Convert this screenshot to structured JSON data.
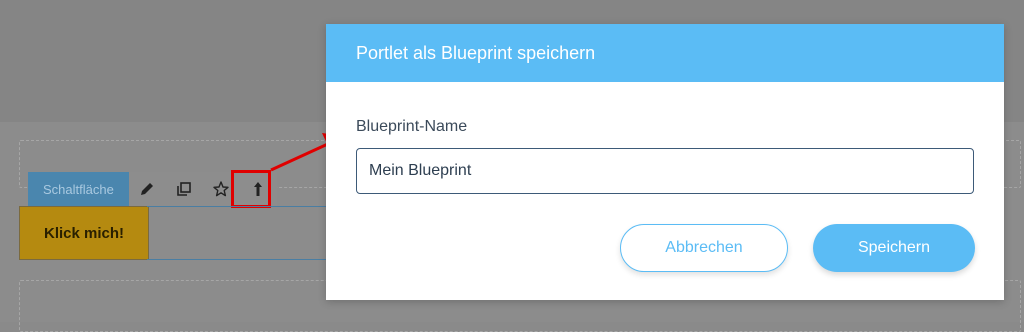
{
  "dialog": {
    "title": "Portlet als Blueprint speichern",
    "field_label": "Blueprint-Name",
    "field_value": "Mein Blueprint",
    "cancel_label": "Abbrechen",
    "save_label": "Speichern"
  },
  "portlet_toolbar": {
    "label": "Schaltfläche",
    "icons": [
      "pencil-icon",
      "copy-icon",
      "star-icon",
      "move-up-icon"
    ]
  },
  "button_preview": {
    "text": "Klick mich!"
  },
  "colors": {
    "accent": "#5bbcf5",
    "highlight": "#e00000",
    "button_yellow": "#b58a10"
  }
}
